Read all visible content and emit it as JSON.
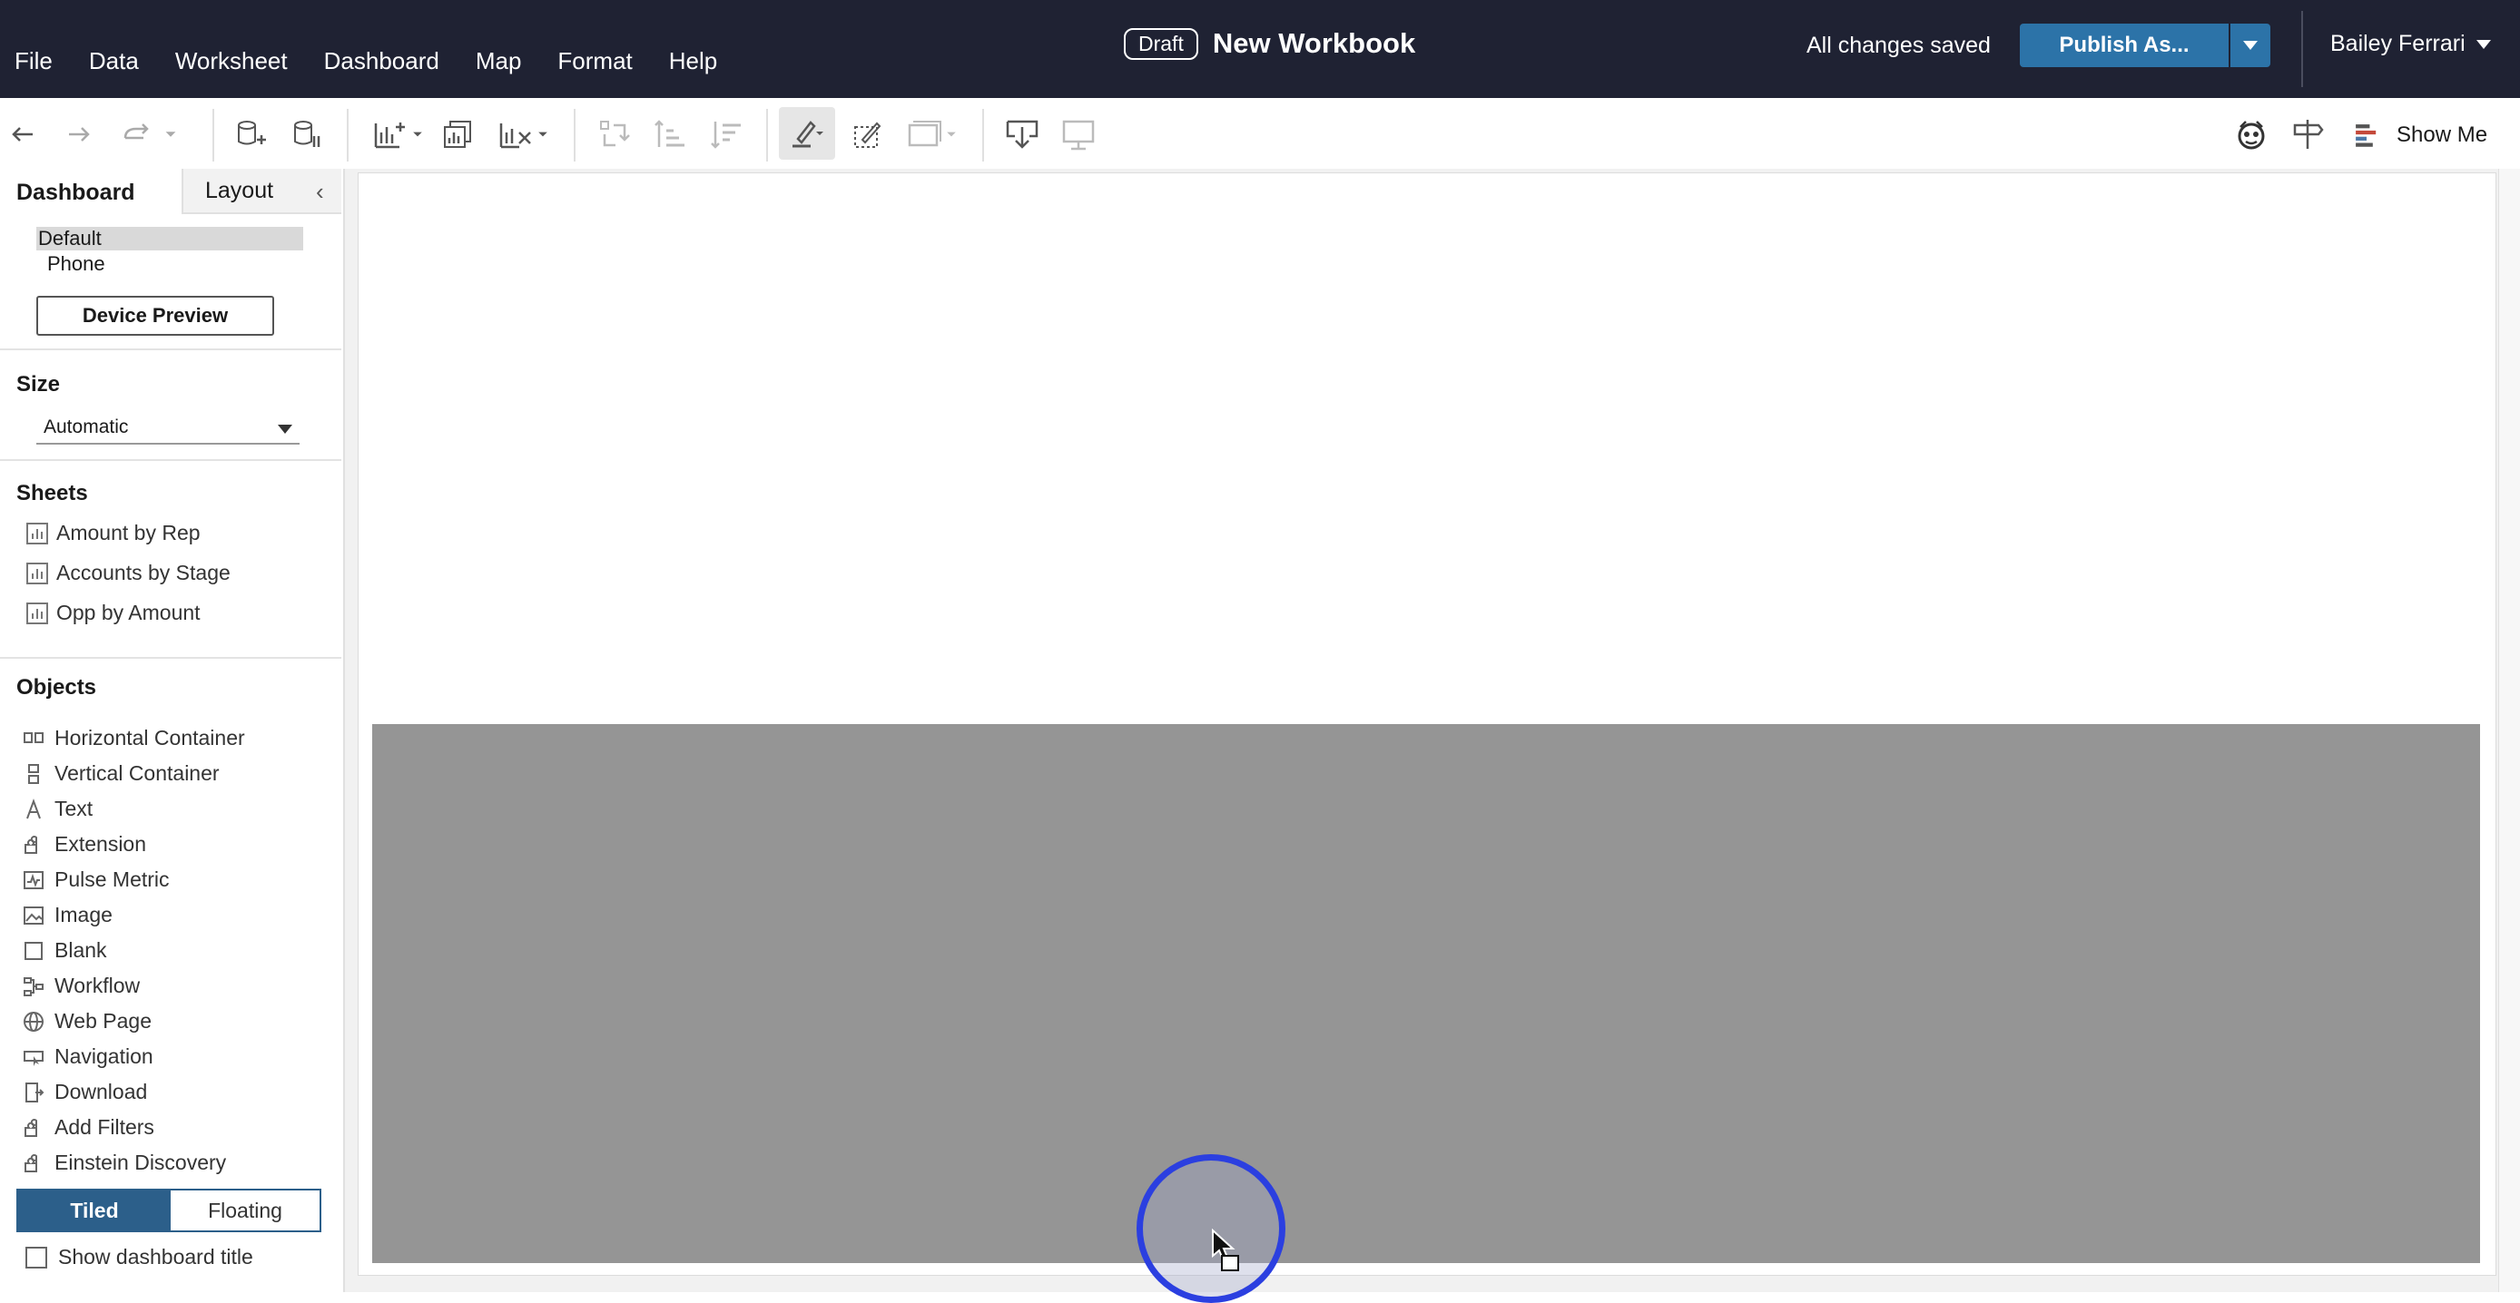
{
  "menu": [
    "File",
    "Data",
    "Worksheet",
    "Dashboard",
    "Map",
    "Format",
    "Help"
  ],
  "header": {
    "badge": "Draft",
    "title": "New Workbook",
    "save_status": "All changes saved",
    "publish_label": "Publish As...",
    "user_name": "Bailey Ferrari"
  },
  "toolbar": {
    "show_me_label": "Show Me"
  },
  "left_panel": {
    "tabs": {
      "dashboard": "Dashboard",
      "layout": "Layout"
    },
    "devices": [
      "Default",
      "Phone"
    ],
    "device_preview_label": "Device Preview",
    "size": {
      "title": "Size",
      "value": "Automatic"
    },
    "sheets": {
      "title": "Sheets",
      "items": [
        "Amount by Rep",
        "Accounts by Stage",
        "Opp by Amount"
      ]
    },
    "objects": {
      "title": "Objects",
      "items": [
        {
          "label": "Horizontal Container",
          "icon": "horizontal-container-icon"
        },
        {
          "label": "Vertical Container",
          "icon": "vertical-container-icon"
        },
        {
          "label": "Text",
          "icon": "text-icon"
        },
        {
          "label": "Extension",
          "icon": "extension-icon"
        },
        {
          "label": "Pulse Metric",
          "icon": "pulse-metric-icon"
        },
        {
          "label": "Image",
          "icon": "image-icon"
        },
        {
          "label": "Blank",
          "icon": "blank-icon"
        },
        {
          "label": "Workflow",
          "icon": "workflow-icon"
        },
        {
          "label": "Web Page",
          "icon": "web-page-icon"
        },
        {
          "label": "Navigation",
          "icon": "navigation-icon"
        },
        {
          "label": "Download",
          "icon": "download-icon"
        },
        {
          "label": "Add Filters",
          "icon": "add-filters-icon"
        },
        {
          "label": "Einstein Discovery",
          "icon": "einstein-discovery-icon"
        }
      ]
    },
    "mode": {
      "tiled": "Tiled",
      "floating": "Floating",
      "selected": "Tiled"
    },
    "show_title_label": "Show dashboard title",
    "show_title_checked": false
  },
  "colors": {
    "topbar": "#1f2233",
    "accent": "#2c73a8",
    "tiled_selected": "#2c5f8a",
    "drop_zone": "#959595",
    "click_ring": "#2b3fe0"
  }
}
